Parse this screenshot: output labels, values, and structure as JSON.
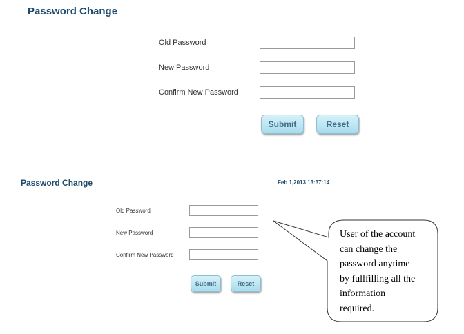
{
  "top_form": {
    "title": "Password Change",
    "old_password_label": "Old Password",
    "new_password_label": "New Password",
    "confirm_password_label": "Confirm New Password",
    "old_password_value": "",
    "new_password_value": "",
    "confirm_password_value": "",
    "submit_label": "Submit",
    "reset_label": "Reset"
  },
  "bottom_form": {
    "title": "Password Change",
    "datetime": "Feb 1,2013 13:37:14",
    "old_password_label": "Old Password",
    "new_password_label": "New Password",
    "confirm_password_label": "Confirm New Password",
    "old_password_value": "",
    "new_password_value": "",
    "confirm_password_value": "",
    "submit_label": "Submit",
    "reset_label": "Reset"
  },
  "callout": {
    "lines": [
      "User of the account",
      "can change the",
      "password anytime",
      "by fullfilling all the",
      "information",
      "required."
    ]
  }
}
